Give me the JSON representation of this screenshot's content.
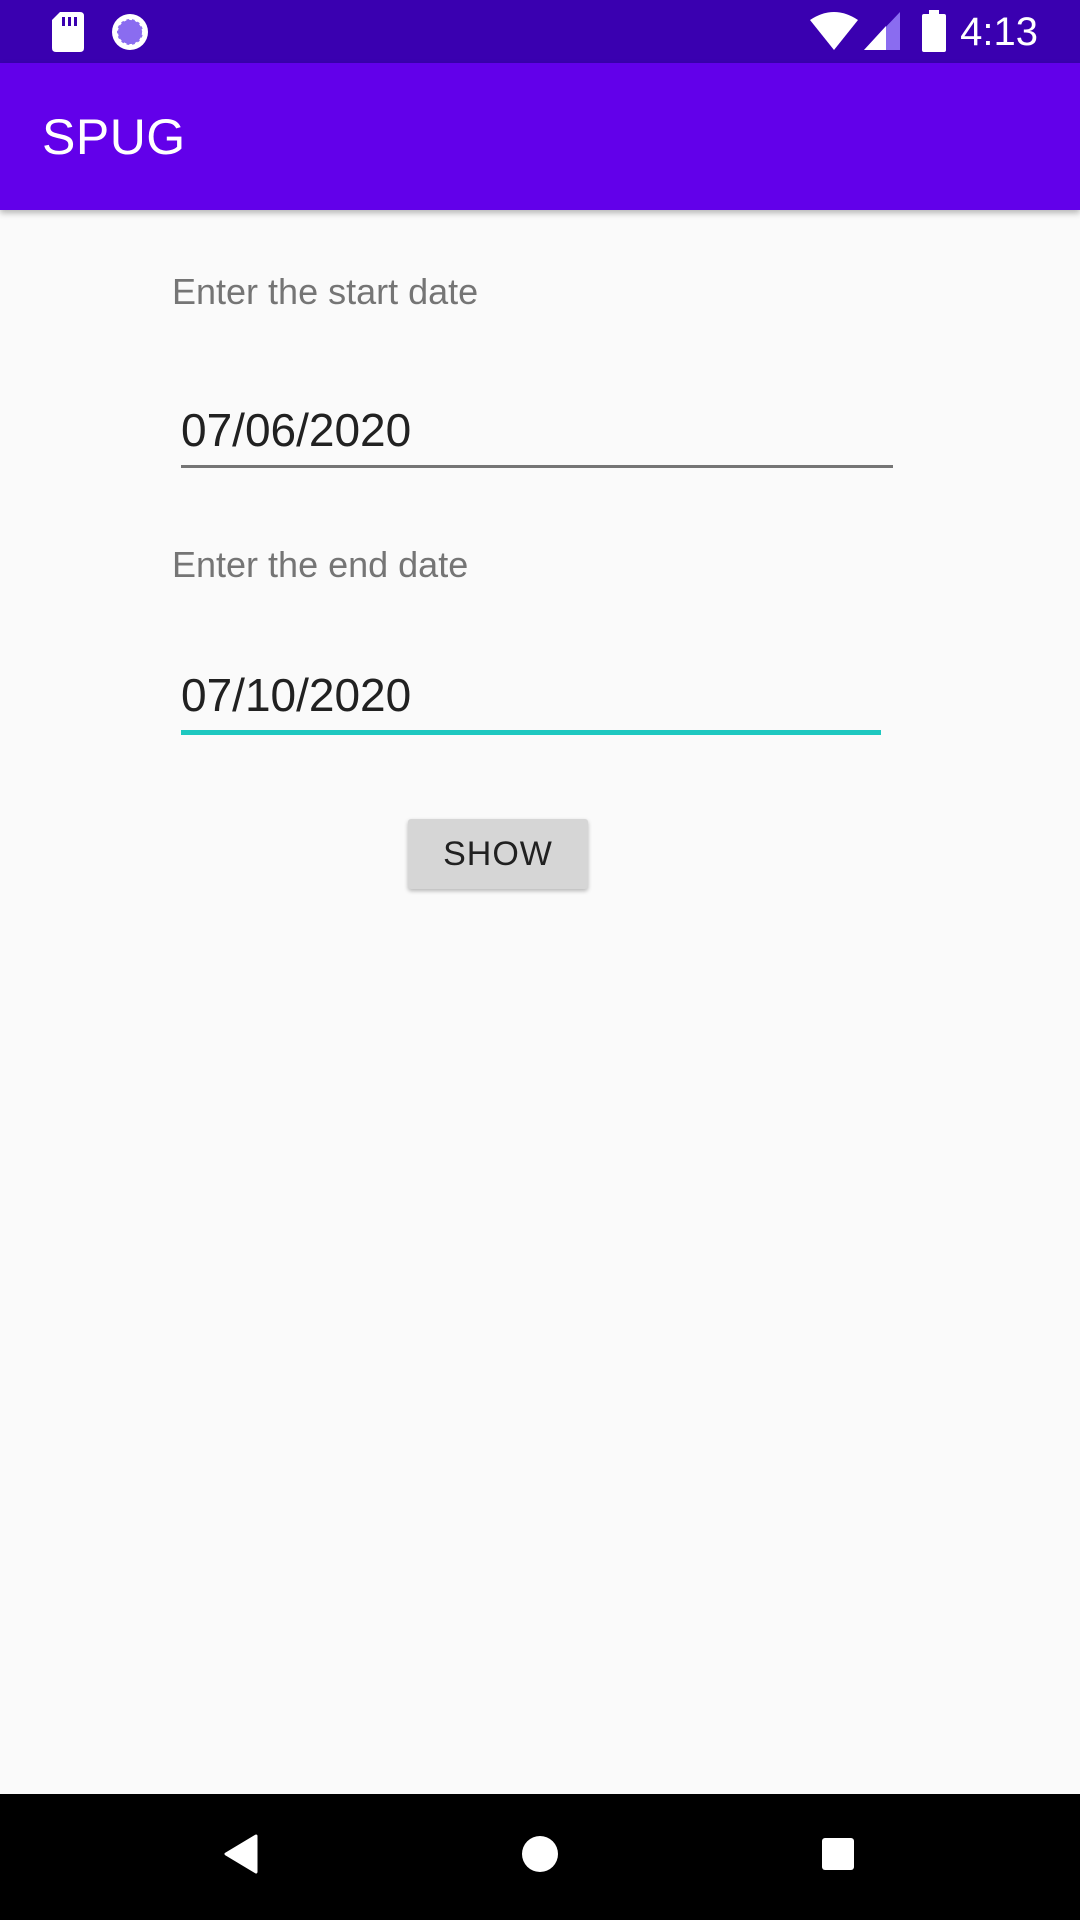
{
  "status_bar": {
    "time": "4:13",
    "icons": [
      "sd-card-icon",
      "sync-icon",
      "wifi-icon",
      "signal-icon",
      "battery-icon"
    ]
  },
  "app_bar": {
    "title": "SPUG"
  },
  "form": {
    "start_label": "Enter the start date",
    "start_value": "07/06/2020",
    "end_label": "Enter the end date",
    "end_value": "07/10/2020",
    "show_button": "SHOW"
  },
  "nav_bar": {
    "icons": [
      "back-icon",
      "home-icon",
      "recents-icon"
    ]
  },
  "colors": {
    "status_bar": "#3a00b0",
    "app_bar": "#6200ea",
    "focused_underline": "#1ec8c0",
    "background": "#fafafa"
  }
}
